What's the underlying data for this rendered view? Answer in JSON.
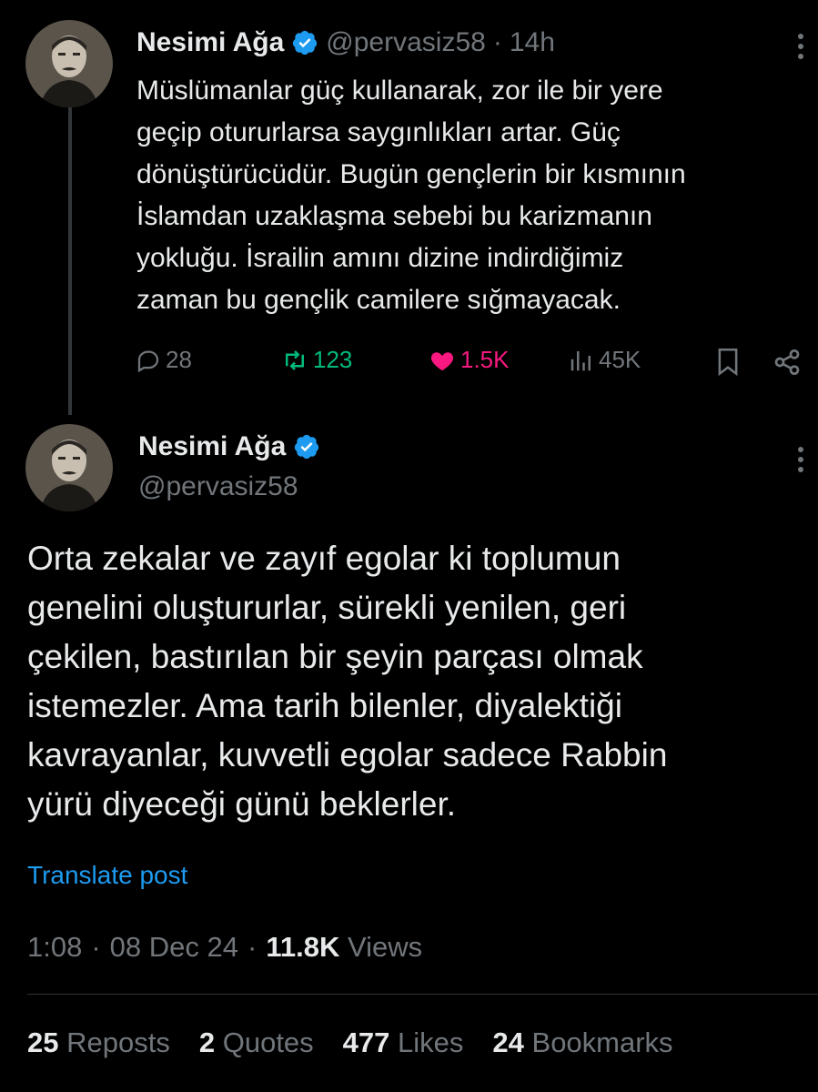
{
  "tweet1": {
    "name": "Nesimi Ağa",
    "handle": "@pervasiz58",
    "dot": "·",
    "time": "14h",
    "lines": [
      "Müslümanlar güç kullanarak, zor ile bir yere",
      "geçip otururlarsa saygınlıkları artar. Güç",
      "dönüştürücüdür. Bugün gençlerin bir kısmının",
      "İslamdan uzaklaşma sebebi bu karizmanın",
      "yokluğu. İsrailin amını dizine indirdiğimiz",
      "zaman bu gençlik camilere sığmayacak."
    ],
    "actions": {
      "replies": "28",
      "reposts": "123",
      "likes": "1.5K",
      "views": "45K"
    }
  },
  "tweet2": {
    "name": "Nesimi Ağa",
    "handle": "@pervasiz58",
    "lines": [
      "Orta zekalar ve zayıf egolar ki toplumun",
      "genelini oluştururlar, sürekli yenilen, geri",
      "çekilen, bastırılan bir şeyin parçası olmak",
      "istemezler. Ama tarih bilenler, diyalektiği",
      "kavrayanlar, kuvvetli egolar sadece Rabbin",
      "yürü diyeceği günü beklerler."
    ],
    "translate": "Translate post",
    "time": "1:08",
    "date": "08 Dec 24",
    "views_count": "11.8K",
    "views_label": "Views",
    "sep": "·",
    "stats": {
      "reposts_count": "25",
      "reposts_label": "Reposts",
      "quotes_count": "2",
      "quotes_label": "Quotes",
      "likes_count": "477",
      "likes_label": "Likes",
      "bookmarks_count": "24",
      "bookmarks_label": "Bookmarks"
    }
  },
  "colors": {
    "background": "#000000",
    "text": "#e7e9ea",
    "muted": "#71767b",
    "accent": "#1d9bf0",
    "repost": "#00ba7c",
    "like": "#f91880"
  },
  "icons": [
    "verified-badge-icon",
    "more-options-icon",
    "reply-icon",
    "repost-icon",
    "heart-icon",
    "views-icon",
    "bookmark-icon",
    "share-icon"
  ]
}
